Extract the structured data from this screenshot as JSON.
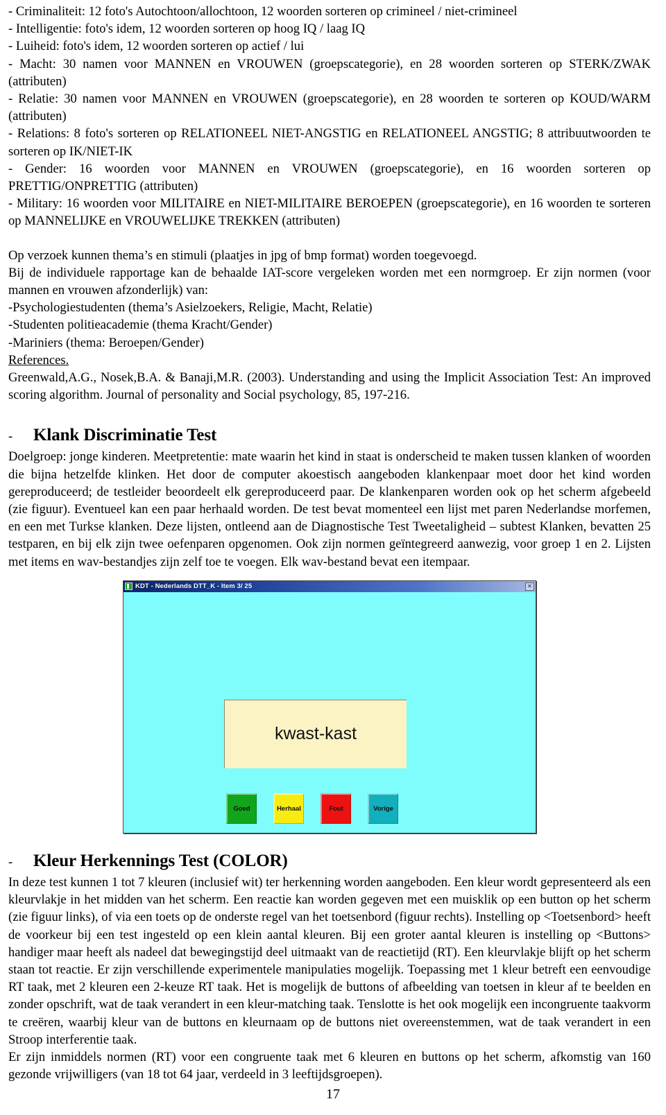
{
  "document": {
    "page_number": "17",
    "theme_list": [
      "- Criminaliteit: 12 foto's Autochtoon/allochtoon, 12 woorden sorteren op crimineel / niet-crimineel",
      "- Intelligentie: foto's idem, 12 woorden sorteren op hoog IQ / laag IQ",
      "- Luiheid: foto's idem, 12 woorden sorteren op actief / lui",
      "- Macht: 30 namen voor MANNEN en VROUWEN (groepscategorie), en 28 woorden sorteren op STERK/ZWAK (attributen)",
      "- Relatie: 30 namen voor MANNEN en VROUWEN (groepscategorie), en 28 woorden te sorteren op KOUD/WARM (attributen)",
      "- Relations: 8 foto's sorteren op RELATIONEEL NIET-ANGSTIG en RELATIONEEL ANGSTIG; 8 attribuutwoorden te sorteren op IK/NIET-IK",
      "- Gender: 16 woorden voor MANNEN en VROUWEN (groepscategorie), en 16 woorden sorteren op PRETTIG/ONPRETTIG (attributen)",
      "- Military: 16 woorden voor MILITAIRE en NIET-MILITAIRE BEROEPEN (groepscategorie), en 16 woorden te sorteren op MANNELIJKE en VROUWELIJKE TREKKEN (attributen)"
    ],
    "iat_notes": {
      "line_request": "Op verzoek kunnen thema’s en stimuli (plaatjes in jpg of bmp format) worden toegevoegd.",
      "line_report": "Bij de individuele rapportage kan de behaalde IAT-score vergeleken worden met een normgroep. Er zijn normen (voor mannen en vrouwen afzonderlijk) van:",
      "norm_groups": [
        "-Psychologiestudenten (thema’s Asielzoekers, Religie, Macht, Relatie)",
        "-Studenten politieacademie (thema Kracht/Gender)",
        "-Mariniers (thema: Beroepen/Gender)"
      ],
      "references_heading": "References.",
      "reference_entry": "Greenwald,A.G., Nosek,B.A. & Banaji,M.R. (2003). Understanding and using the Implicit Association Test: An improved scoring algorithm. Journal of personality and Social psychology, 85, 197-216."
    },
    "section_klank": {
      "bullet": "-",
      "title": "Klank Discriminatie Test",
      "body": "Doelgroep: jonge kinderen. Meetpretentie: mate waarin het kind in staat is onderscheid te maken tussen klanken of woorden die bijna hetzelfde klinken. Het door de computer akoestisch aangeboden klankenpaar moet door het kind worden gereproduceerd; de testleider beoordeelt elk gereproduceerd paar. De klankenparen worden ook op het scherm afgebeeld (zie figuur). Eventueel kan een paar herhaald worden. De test bevat momenteel een lijst met paren Nederlandse morfemen, en een met Turkse klanken. Deze lijsten, ontleend aan de Diagnostische Test Tweetaligheid – subtest Klanken, bevatten 25 testparen, en bij elk zijn twee oefenparen opgenomen. Ook zijn normen geïntegreerd aanwezig, voor groep 1 en 2. Lijsten met items en wav-bestandjes zijn zelf toe te voegen. Elk wav-bestand bevat een itempaar."
    },
    "app_screenshot": {
      "window_title": "KDT - Nederlands DTT_K - Item  3/ 25",
      "title_icon": "app-icon",
      "close_label": "✕",
      "stimulus_word": "kwast-kast",
      "background_color": "#7ffdfd",
      "stimulus_background": "#fbf3c4",
      "buttons": [
        {
          "label": "Goed",
          "color": "#11a51b",
          "name": "goed-button"
        },
        {
          "label": "Herhaal",
          "color": "#f7ec12",
          "name": "herhaal-button"
        },
        {
          "label": "Fout",
          "color": "#ee1111",
          "name": "fout-button"
        },
        {
          "label": "Vorige",
          "color": "#12b0bc",
          "name": "vorige-button"
        }
      ]
    },
    "section_color": {
      "bullet": "-",
      "title": "Kleur Herkennings Test (COLOR)",
      "paragraph1": "In deze test kunnen 1 tot 7 kleuren (inclusief wit) ter herkenning worden aangeboden. Een kleur wordt gepresenteerd als een kleurvlakje in het midden van het scherm. Een reactie kan worden gegeven met een muisklik op een button op het scherm (zie figuur links), of via een toets op de onderste regel van het toetsenbord (figuur rechts). Instelling op <Toetsenbord> heeft de voorkeur bij een test ingesteld op een klein aantal kleuren. Bij een groter aantal kleuren is instelling op <Buttons> handiger maar heeft als nadeel dat bewegingstijd deel uitmaakt van de reactietijd (RT). Een kleurvlakje blijft op het scherm staan tot reactie. Er zijn verschillende experimentele manipulaties mogelijk. Toepassing met 1 kleur betreft een eenvoudige RT taak, met 2 kleuren een 2-keuze RT taak. Het is mogelijk de buttons of afbeelding van toetsen in kleur af te beelden en zonder opschrift, wat de taak verandert in een kleur-matching taak. Tenslotte is het ook mogelijk een incongruente taakvorm te creëren, waarbij kleur van de buttons en kleurnaam op de buttons niet overeenstemmen, wat de taak verandert in een Stroop interferentie taak.",
      "paragraph2": "Er zijn inmiddels normen (RT) voor een congruente taak met 6 kleuren en buttons op het scherm, afkomstig van 160 gezonde vrijwilligers (van 18 tot 64 jaar, verdeeld in 3 leeftijdsgroepen)."
    }
  }
}
